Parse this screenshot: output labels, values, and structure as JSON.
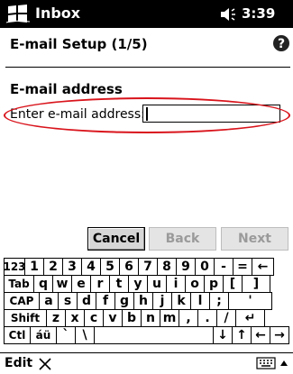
{
  "titlebar": {
    "app_title": "Inbox",
    "time": "3:39",
    "start_icon": "windows-flag-icon",
    "volume_icon": "speaker-icon"
  },
  "page": {
    "title": "E-mail Setup (1/5)",
    "help_icon": "question-mark-icon"
  },
  "form": {
    "heading": "E-mail address",
    "field_label": "Enter e-mail address:",
    "field_value": ""
  },
  "buttons": {
    "cancel": "Cancel",
    "back": "Back",
    "next": "Next"
  },
  "keyboard": {
    "rows": [
      [
        "123",
        "1",
        "2",
        "3",
        "4",
        "5",
        "6",
        "7",
        "8",
        "9",
        "0",
        "-",
        "=",
        "←"
      ],
      [
        "Tab",
        "q",
        "w",
        "e",
        "r",
        "t",
        "y",
        "u",
        "i",
        "o",
        "p",
        "[",
        "]"
      ],
      [
        "CAP",
        "a",
        "s",
        "d",
        "f",
        "g",
        "h",
        "j",
        "k",
        "l",
        ";",
        "'"
      ],
      [
        "Shift",
        "z",
        "x",
        "c",
        "v",
        "b",
        "n",
        "m",
        ",",
        ".",
        "/",
        "↵"
      ],
      [
        "Ctl",
        "áü",
        "`",
        "\\",
        "",
        "↓",
        "↑",
        "←",
        "→"
      ]
    ]
  },
  "bottombar": {
    "menu_label": "Edit",
    "close_icon": "close-x-icon",
    "keyboard_icon": "keyboard-icon",
    "sip_arrow": "up-arrow-icon"
  },
  "colors": {
    "accent_highlight": "#d9141c",
    "titlebar_bg": "#000000",
    "disabled_text": "#9a9a9a"
  }
}
